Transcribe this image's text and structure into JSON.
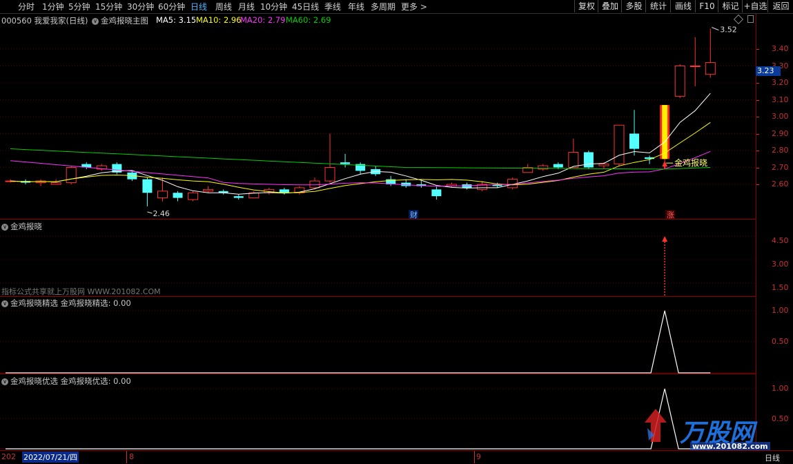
{
  "toolbar": {
    "periods": [
      "分时",
      "1分钟",
      "5分钟",
      "15分钟",
      "30分钟",
      "60分钟",
      "日线",
      "周线",
      "月线",
      "10分钟",
      "45日线",
      "季线",
      "年线",
      "多周期",
      "更多 >"
    ],
    "active_period": "日线",
    "buttons": [
      "复权",
      "叠加",
      "多股",
      "统计",
      "画线",
      "F10",
      "标记",
      "+自选",
      "返回"
    ]
  },
  "header": {
    "stock": "000560 我爱我家(日线)",
    "indicator": "金鸡报晓主图",
    "ma5": "MA5: 3.15",
    "ma10": "MA10: 2.96",
    "ma20": "MA20: 2.79",
    "ma60": "MA60: 2.69"
  },
  "colors": {
    "ma5": "#ffffff",
    "ma10": "#ffff00",
    "ma20": "#ff33ff",
    "ma60": "#00d000",
    "up": "#ff3333",
    "down": "#54ffff"
  },
  "main_chart": {
    "y_ticks": [
      "3.40",
      "3.30",
      "3.20",
      "3.10",
      "3.00",
      "2.90",
      "2.80",
      "2.70",
      "2.60"
    ],
    "current_price": "3.23",
    "high_label": "3.52",
    "low_label": "2.46",
    "signal_label": "金鸡报晓",
    "badge_cai": "财",
    "badge_zhang": "涨"
  },
  "panel1": {
    "title": "金鸡报晓",
    "y_ticks": [
      "4.50",
      "3.00",
      "1.50"
    ],
    "watermark": "指标公式共享就上万股网 WWW.201082.COM"
  },
  "panel2": {
    "title": "金鸡报晓精选 金鸡报晓精选: 0.00",
    "y_ticks": [
      "1.00",
      "0.50"
    ]
  },
  "panel3": {
    "title": "金鸡报晓优选 金鸡报晓优选: 0.00",
    "y_ticks": [
      "1.00",
      "0.50"
    ]
  },
  "bottom_axis": {
    "left_cut": "202",
    "date": "2022/07/21/四",
    "month8": "8",
    "month9": "9",
    "period": "日线"
  },
  "logo": {
    "text": "万股网",
    "url": "www.201082.com"
  },
  "chart_data": {
    "type": "candlestick",
    "ylim": [
      2.45,
      3.55
    ],
    "candles": [
      [
        2.62,
        2.62,
        2.63,
        2.61
      ],
      [
        2.62,
        2.61,
        2.63,
        2.6
      ],
      [
        2.61,
        2.62,
        2.63,
        2.59
      ],
      [
        2.6,
        2.61,
        2.63,
        2.6
      ],
      [
        2.61,
        2.7,
        2.71,
        2.6
      ],
      [
        2.72,
        2.7,
        2.73,
        2.69
      ],
      [
        2.69,
        2.71,
        2.72,
        2.68
      ],
      [
        2.72,
        2.67,
        2.73,
        2.66
      ],
      [
        2.67,
        2.63,
        2.68,
        2.62
      ],
      [
        2.63,
        2.55,
        2.64,
        2.47
      ],
      [
        2.52,
        2.56,
        2.64,
        2.5
      ],
      [
        2.55,
        2.52,
        2.56,
        2.5
      ],
      [
        2.51,
        2.55,
        2.56,
        2.5
      ],
      [
        2.56,
        2.57,
        2.59,
        2.55
      ],
      [
        2.56,
        2.55,
        2.57,
        2.54
      ],
      [
        2.53,
        2.52,
        2.54,
        2.51
      ],
      [
        2.52,
        2.55,
        2.56,
        2.52
      ],
      [
        2.55,
        2.57,
        2.58,
        2.54
      ],
      [
        2.57,
        2.55,
        2.58,
        2.54
      ],
      [
        2.55,
        2.58,
        2.59,
        2.54
      ],
      [
        2.58,
        2.62,
        2.64,
        2.57
      ],
      [
        2.62,
        2.7,
        2.9,
        2.61
      ],
      [
        2.73,
        2.72,
        2.78,
        2.7
      ],
      [
        2.72,
        2.68,
        2.73,
        2.66
      ],
      [
        2.69,
        2.66,
        2.71,
        2.65
      ],
      [
        2.63,
        2.6,
        2.65,
        2.59
      ],
      [
        2.61,
        2.59,
        2.63,
        2.58
      ],
      [
        2.6,
        2.59,
        2.62,
        2.58
      ],
      [
        2.57,
        2.53,
        2.59,
        2.51
      ],
      [
        2.59,
        2.6,
        2.61,
        2.58
      ],
      [
        2.6,
        2.58,
        2.61,
        2.57
      ],
      [
        2.57,
        2.6,
        2.62,
        2.56
      ],
      [
        2.6,
        2.59,
        2.61,
        2.58
      ],
      [
        2.58,
        2.63,
        2.64,
        2.57
      ],
      [
        2.67,
        2.7,
        2.72,
        2.67
      ],
      [
        2.69,
        2.71,
        2.72,
        2.68
      ],
      [
        2.72,
        2.7,
        2.73,
        2.69
      ],
      [
        2.7,
        2.79,
        2.87,
        2.7
      ],
      [
        2.79,
        2.7,
        2.8,
        2.69
      ],
      [
        2.71,
        2.72,
        2.73,
        2.69
      ],
      [
        2.72,
        2.95,
        2.95,
        2.71
      ],
      [
        2.9,
        2.81,
        3.04,
        2.77
      ],
      [
        2.76,
        2.75,
        2.77,
        2.72
      ],
      [
        2.75,
        3.02,
        3.02,
        2.73
      ],
      [
        3.12,
        3.3,
        3.31,
        3.11
      ],
      [
        3.3,
        3.3,
        3.47,
        3.18
      ],
      [
        3.25,
        3.32,
        3.52,
        3.23
      ]
    ],
    "signal_candle_index": 43,
    "ma5_start": 2.72,
    "ma60_start": 2.81
  }
}
